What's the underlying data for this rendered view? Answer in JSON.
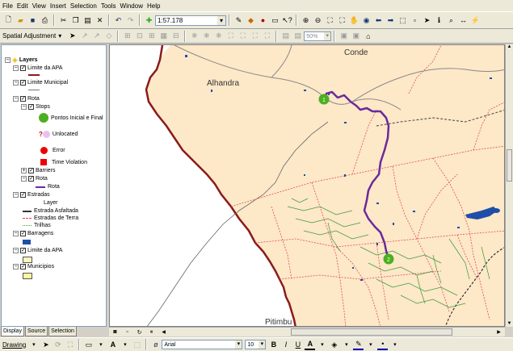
{
  "menu": [
    "File",
    "Edit",
    "View",
    "Insert",
    "Selection",
    "Tools",
    "Window",
    "Help"
  ],
  "toolbar": {
    "scale": "1:57.178",
    "zoom": "50%"
  },
  "toolbar2": {
    "label": "Spatial Adjustment",
    "dropdown_arrow": "▾"
  },
  "toc": {
    "root": "Layers",
    "items": [
      {
        "label": "Limite da APA"
      },
      {
        "label": "Limite Municipal"
      },
      {
        "label": "Rota"
      },
      {
        "label": "Stops"
      },
      {
        "label": "Pontos Inicial e Final"
      },
      {
        "label": "Unlocated"
      },
      {
        "label": "Error"
      },
      {
        "label": "Time Violation"
      },
      {
        "label": "Barriers"
      },
      {
        "label": "Rota"
      },
      {
        "label": "Rota"
      },
      {
        "label": "Estradas"
      },
      {
        "label": "Layer"
      },
      {
        "label": "Estrada Asfaltada"
      },
      {
        "label": "Estradas de Terra"
      },
      {
        "label": "Trilhas"
      },
      {
        "label": "Barragens"
      },
      {
        "label": "Limite da APA"
      },
      {
        "label": "Municipios"
      }
    ],
    "tabs": [
      "Display",
      "Source",
      "Selection"
    ]
  },
  "map": {
    "labels": [
      "Conde",
      "Alhandra",
      "Pitimbu"
    ],
    "stop1": "1",
    "stop2": "2"
  },
  "drawing": {
    "label": "Drawing",
    "font": "Arial",
    "size": "10",
    "bold": "B",
    "italic": "I",
    "underline": "U",
    "font_color": "A"
  },
  "colors": {
    "land": "#fde8c8",
    "route": "#6a2a9a",
    "apa": "#8b1a1a",
    "stop": "#4caf20",
    "water": "#1e4ea8"
  }
}
